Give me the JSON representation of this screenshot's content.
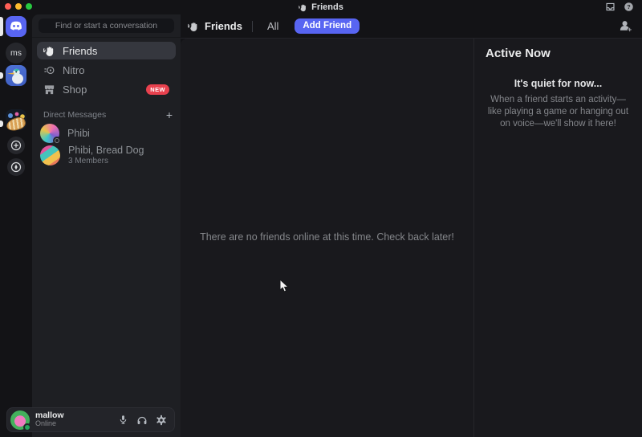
{
  "titlebar": {
    "title": "Friends"
  },
  "rail": {
    "server_ms_label": "ms"
  },
  "sidebar": {
    "search_placeholder": "Find or start a conversation",
    "nav": [
      {
        "label": "Friends"
      },
      {
        "label": "Nitro"
      },
      {
        "label": "Shop",
        "badge": "NEW"
      }
    ],
    "dm_header": "Direct Messages",
    "dm_add": "+",
    "dms": [
      {
        "name": "Phibi"
      },
      {
        "name": "Phibi, Bread Dog",
        "members": "3 Members"
      }
    ]
  },
  "user": {
    "name": "mallow",
    "status": "Online"
  },
  "header": {
    "title": "Friends",
    "tab_all": "All",
    "add_friend_label": "Add Friend"
  },
  "main": {
    "empty_text": "There are no friends online at this time. Check back later!"
  },
  "active_now": {
    "title": "Active Now",
    "quiet_title": "It's quiet for now...",
    "quiet_body": "When a friend starts an activity—like playing a game or hanging out on voice—we'll show it here!"
  },
  "colors": {
    "blurple": "#5865f2",
    "new_badge": "#e8414e",
    "online_green": "#23a55a"
  }
}
